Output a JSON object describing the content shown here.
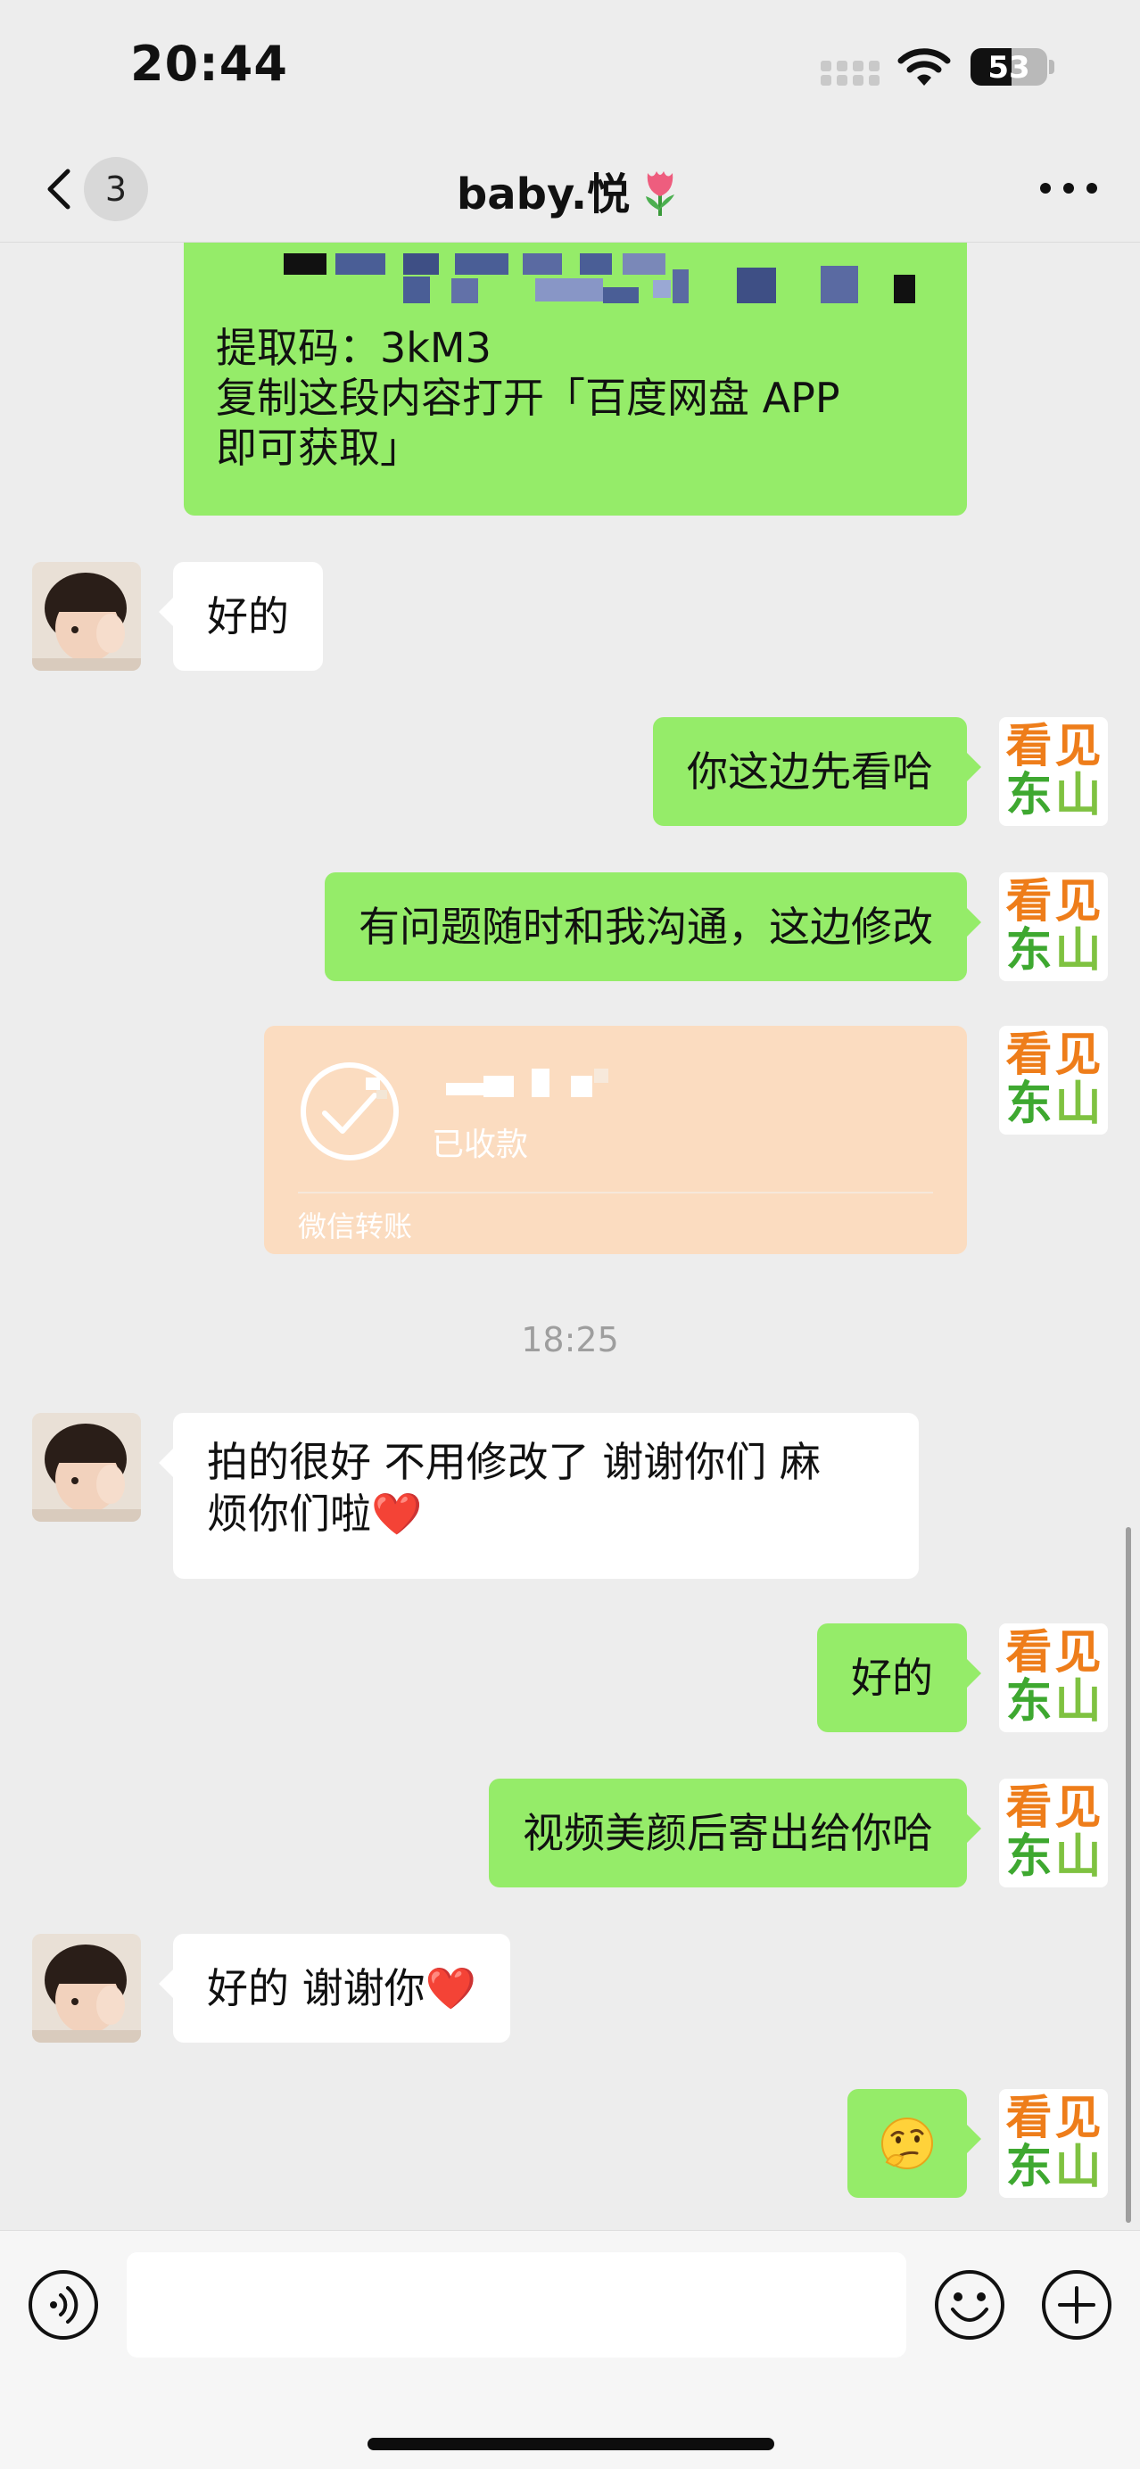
{
  "status_bar": {
    "time": "20:44",
    "battery_level": "53"
  },
  "nav": {
    "unread_count": "3",
    "title": "baby.悦"
  },
  "brand_avatar": {
    "chars": [
      "看",
      "见",
      "东",
      "山"
    ],
    "colors": [
      "#ee7d1a",
      "#ee7d1a",
      "#3ea830",
      "#7fc241"
    ]
  },
  "messages": [
    {
      "from": "me",
      "type": "link",
      "lines": [
        "提取码：3kM3",
        "复制这段内容打开「百度网盘 APP",
        "即可获取」"
      ]
    },
    {
      "from": "other",
      "type": "text",
      "text": "好的"
    },
    {
      "from": "me",
      "type": "text",
      "text": "你这边先看哈"
    },
    {
      "from": "me",
      "type": "text",
      "text": "有问题随时和我沟通，这边修改"
    },
    {
      "from": "me",
      "type": "transfer",
      "status": "已收款",
      "label": "微信转账"
    },
    {
      "type": "time",
      "text": "18:25"
    },
    {
      "from": "other",
      "type": "text",
      "lines": [
        "拍的很好 不用修改了 谢谢你们 麻",
        "烦你们啦❤️"
      ]
    },
    {
      "from": "me",
      "type": "text",
      "text": "好的"
    },
    {
      "from": "me",
      "type": "text",
      "text": "视频美颜后寄出给你哈"
    },
    {
      "from": "other",
      "type": "text",
      "text": "好的 谢谢你❤️"
    },
    {
      "from": "me",
      "type": "sticker",
      "emoji": "🤔"
    }
  ],
  "input": {
    "value": "",
    "placeholder": ""
  },
  "colors": {
    "mine_bubble": "#95ec69",
    "theirs_bubble": "#ffffff",
    "background": "#ededed",
    "transfer_card": "#fbdcc0"
  }
}
